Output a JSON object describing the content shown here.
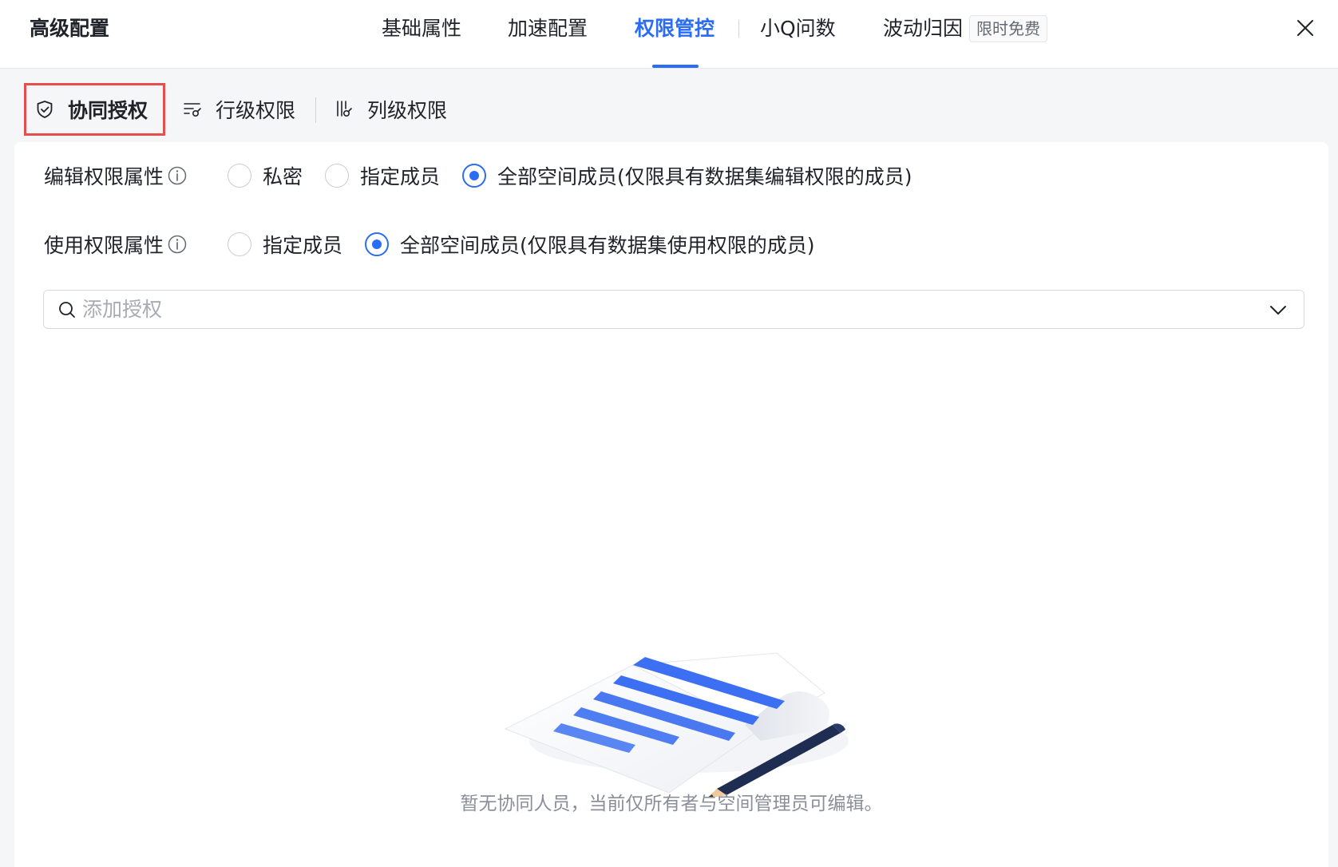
{
  "header": {
    "title": "高级配置",
    "tabs": [
      {
        "label": "基础属性"
      },
      {
        "label": "加速配置"
      },
      {
        "label": "权限管控"
      },
      {
        "label": "小Q问数"
      },
      {
        "label": "波动归因"
      }
    ],
    "active_tab": "权限管控",
    "promo_badge": "限时免费"
  },
  "subtabs": {
    "items": [
      {
        "label": "协同授权",
        "icon": "shield-icon"
      },
      {
        "label": "行级权限",
        "icon": "row-filter-icon"
      },
      {
        "label": "列级权限",
        "icon": "column-filter-icon"
      }
    ],
    "active": "协同授权"
  },
  "edit_permission": {
    "label": "编辑权限属性",
    "options": [
      {
        "label": "私密",
        "checked": false
      },
      {
        "label": "指定成员",
        "checked": false
      },
      {
        "label": "全部空间成员(仅限具有数据集编辑权限的成员)",
        "checked": true
      }
    ]
  },
  "use_permission": {
    "label": "使用权限属性",
    "options": [
      {
        "label": "指定成员",
        "checked": false
      },
      {
        "label": "全部空间成员(仅限具有数据集使用权限的成员)",
        "checked": true
      }
    ]
  },
  "search": {
    "placeholder": "添加授权",
    "value": ""
  },
  "empty_state": {
    "message": "暂无协同人员，当前仅所有者与空间管理员可编辑。"
  },
  "colors": {
    "accent": "#2b6cf5",
    "highlight_border": "#e84d4d"
  }
}
